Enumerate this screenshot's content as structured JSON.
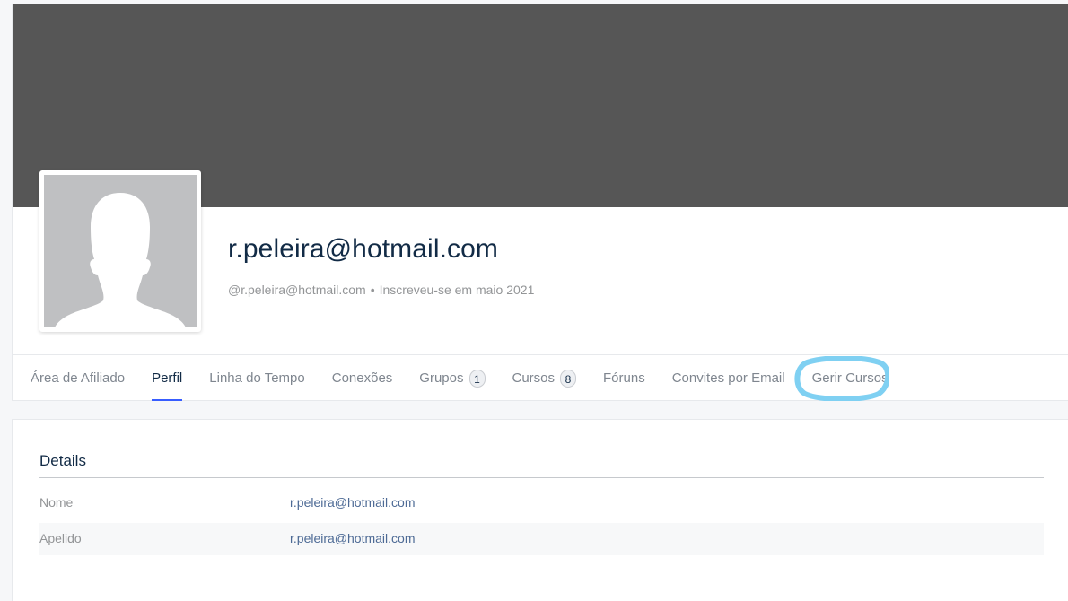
{
  "profile": {
    "name": "r.peleira@hotmail.com",
    "handle": "@r.peleira@hotmail.com",
    "separator": "•",
    "joined": "Inscreveu-se em maio 2021"
  },
  "nav": {
    "items": [
      {
        "label": "Área de Afiliado",
        "active": false
      },
      {
        "label": "Perfil",
        "active": true
      },
      {
        "label": "Linha do Tempo",
        "active": false
      },
      {
        "label": "Conexões",
        "active": false
      },
      {
        "label": "Grupos",
        "count": "1",
        "active": false
      },
      {
        "label": "Cursos",
        "count": "8",
        "active": false
      },
      {
        "label": "Fóruns",
        "active": false
      },
      {
        "label": "Convites por Email",
        "active": false
      },
      {
        "label": "Gerir Cursos",
        "active": false
      }
    ],
    "highlight_color": "#7fd0f2"
  },
  "details": {
    "title": "Details",
    "rows": [
      {
        "label": "Nome",
        "value": "r.peleira@hotmail.com"
      },
      {
        "label": "Apelido",
        "value": "r.peleira@hotmail.com"
      }
    ]
  },
  "colors": {
    "cover": "#565656",
    "accent": "#385dff",
    "link": "#4d6a95"
  }
}
